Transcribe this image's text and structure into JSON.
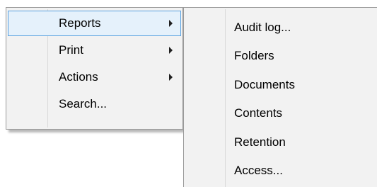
{
  "context_menu": {
    "items": [
      {
        "label": "Reports",
        "has_submenu": true,
        "selected": true
      },
      {
        "label": "Print",
        "has_submenu": true,
        "selected": false
      },
      {
        "label": "Actions",
        "has_submenu": true,
        "selected": false
      },
      {
        "label": "Search...",
        "has_submenu": false,
        "selected": false
      }
    ]
  },
  "reports_submenu": {
    "items": [
      {
        "label": "Audit log..."
      },
      {
        "label": "Folders"
      },
      {
        "label": "Documents"
      },
      {
        "label": "Contents"
      },
      {
        "label": "Retention"
      },
      {
        "label": "Access..."
      }
    ]
  },
  "colors": {
    "menu_background": "#f2f2f2",
    "selection_fill": "#e5f1fb",
    "selection_border": "#5aa1e0",
    "menu_border": "#9a9a9a"
  }
}
